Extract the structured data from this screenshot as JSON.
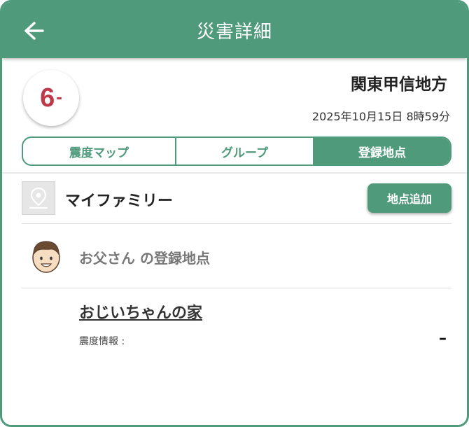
{
  "header": {
    "title": "災害詳細",
    "back_icon": "arrow-left-icon"
  },
  "quake": {
    "intensity": "6",
    "intensity_suffix": "-",
    "region": "関東甲信地方",
    "datetime": "2025年10月15日 8時59分"
  },
  "tabs": [
    {
      "label": "震度マップ",
      "active": false
    },
    {
      "label": "グループ",
      "active": false
    },
    {
      "label": "登録地点",
      "active": true
    }
  ],
  "group": {
    "icon": "map-pin-icon",
    "name": "マイファミリー",
    "add_button": "地点追加"
  },
  "member": {
    "avatar": "father-avatar",
    "label": "お父さん の登録地点"
  },
  "place": {
    "name": "おじいちゃんの家",
    "intensity_label": "震度情報 :",
    "intensity_value": "–"
  },
  "colors": {
    "primary": "#4f9a7b",
    "intensity": "#c0394b"
  }
}
